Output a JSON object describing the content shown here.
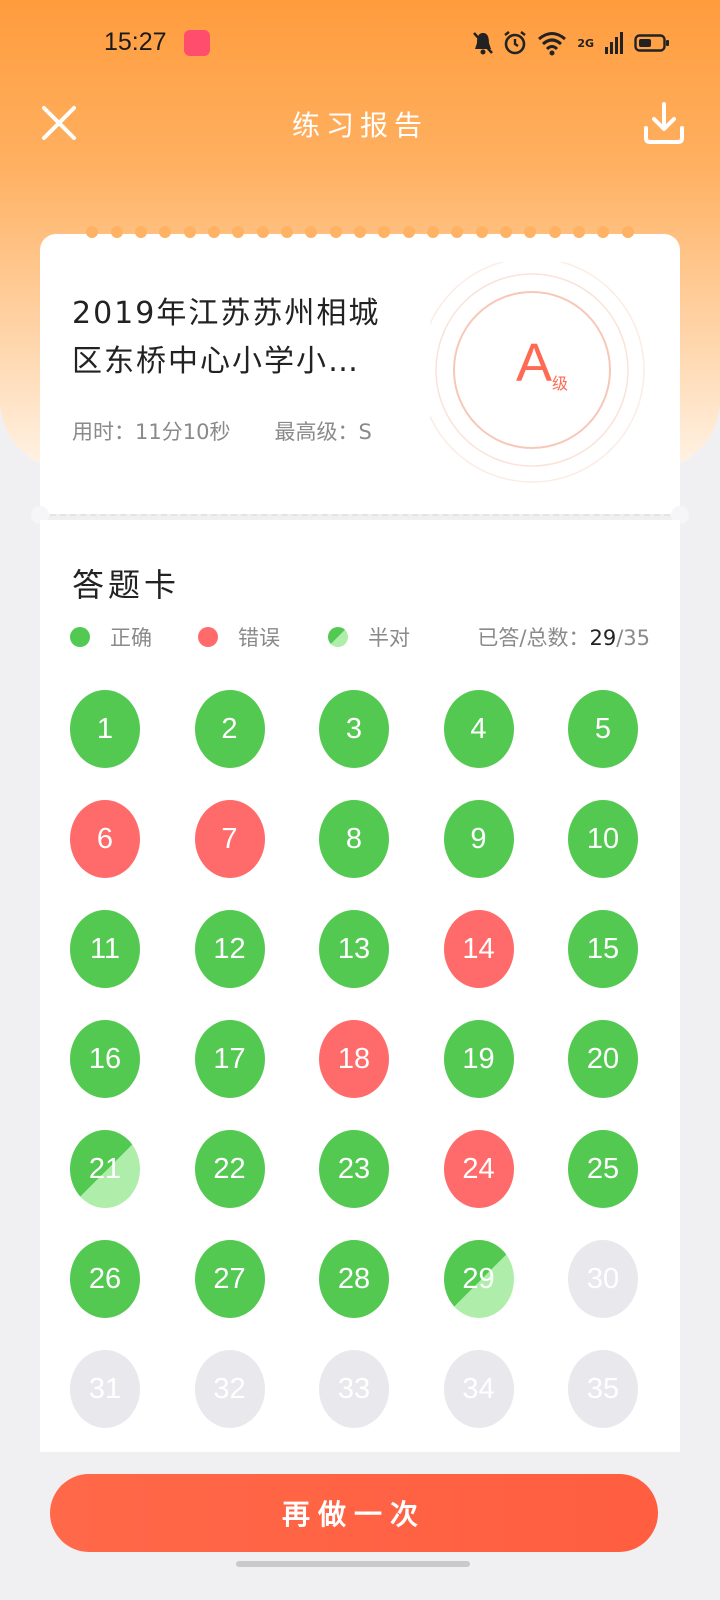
{
  "status_bar": {
    "time": "15:27",
    "network": "2G"
  },
  "nav": {
    "title": "练习报告"
  },
  "report": {
    "title": "2019年江苏苏州相城区东桥中心小学小…",
    "time_used": "用时：11分10秒",
    "highest_level": "最高级：S",
    "grade": "A",
    "grade_suffix": "级"
  },
  "answer_card": {
    "title": "答题卡",
    "legend": {
      "correct": "正确",
      "wrong": "错误",
      "half": "半对"
    },
    "answered_label": "已答/总数：",
    "answered": "29",
    "total": "/35",
    "questions": [
      {
        "n": "1",
        "s": "correct"
      },
      {
        "n": "2",
        "s": "correct"
      },
      {
        "n": "3",
        "s": "correct"
      },
      {
        "n": "4",
        "s": "correct"
      },
      {
        "n": "5",
        "s": "correct"
      },
      {
        "n": "6",
        "s": "wrong"
      },
      {
        "n": "7",
        "s": "wrong"
      },
      {
        "n": "8",
        "s": "correct"
      },
      {
        "n": "9",
        "s": "correct"
      },
      {
        "n": "10",
        "s": "correct"
      },
      {
        "n": "11",
        "s": "correct"
      },
      {
        "n": "12",
        "s": "correct"
      },
      {
        "n": "13",
        "s": "correct"
      },
      {
        "n": "14",
        "s": "wrong"
      },
      {
        "n": "15",
        "s": "correct"
      },
      {
        "n": "16",
        "s": "correct"
      },
      {
        "n": "17",
        "s": "correct"
      },
      {
        "n": "18",
        "s": "wrong"
      },
      {
        "n": "19",
        "s": "correct"
      },
      {
        "n": "20",
        "s": "correct"
      },
      {
        "n": "21",
        "s": "half"
      },
      {
        "n": "22",
        "s": "correct"
      },
      {
        "n": "23",
        "s": "correct"
      },
      {
        "n": "24",
        "s": "wrong"
      },
      {
        "n": "25",
        "s": "correct"
      },
      {
        "n": "26",
        "s": "correct"
      },
      {
        "n": "27",
        "s": "correct"
      },
      {
        "n": "28",
        "s": "correct"
      },
      {
        "n": "29",
        "s": "half"
      },
      {
        "n": "30",
        "s": "empty"
      },
      {
        "n": "31",
        "s": "empty"
      },
      {
        "n": "32",
        "s": "empty"
      },
      {
        "n": "33",
        "s": "empty"
      },
      {
        "n": "34",
        "s": "empty"
      },
      {
        "n": "35",
        "s": "empty"
      }
    ]
  },
  "actions": {
    "retry": "再做一次"
  },
  "colors": {
    "correct": "#53c952",
    "wrong": "#ff6b6b",
    "half": "#aeeeaa",
    "empty": "#e9e9ed",
    "accent": "#ff6848",
    "grade": "#ff6a55"
  }
}
